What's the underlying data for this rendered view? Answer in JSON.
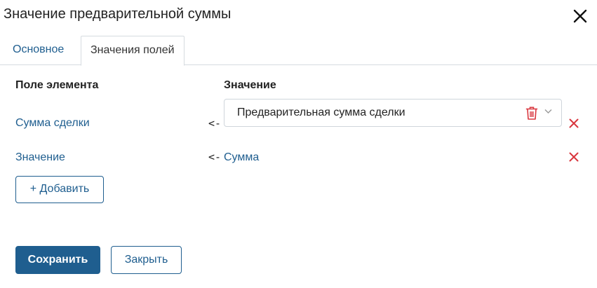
{
  "dialog": {
    "title": "Значение предварительной суммы"
  },
  "tabs": [
    {
      "label": "Основное"
    },
    {
      "label": "Значения полей"
    }
  ],
  "columns": {
    "field": "Поле элемента",
    "value": "Значение"
  },
  "rows": [
    {
      "field": "Сумма сделки",
      "arrow": "<-",
      "value": "Предварительная сумма сделки"
    },
    {
      "field": "Значение",
      "arrow": "<-",
      "value": "Сумма"
    }
  ],
  "buttons": {
    "add": "+ Добавить",
    "save": "Сохранить",
    "close": "Закрыть"
  },
  "icons": {
    "dialog_close": "close-icon",
    "trash": "trash-icon",
    "chevron": "chevron-down-icon",
    "row_delete": "close-icon"
  },
  "colors": {
    "accent": "#1f5e8f",
    "danger": "#d9363e"
  }
}
